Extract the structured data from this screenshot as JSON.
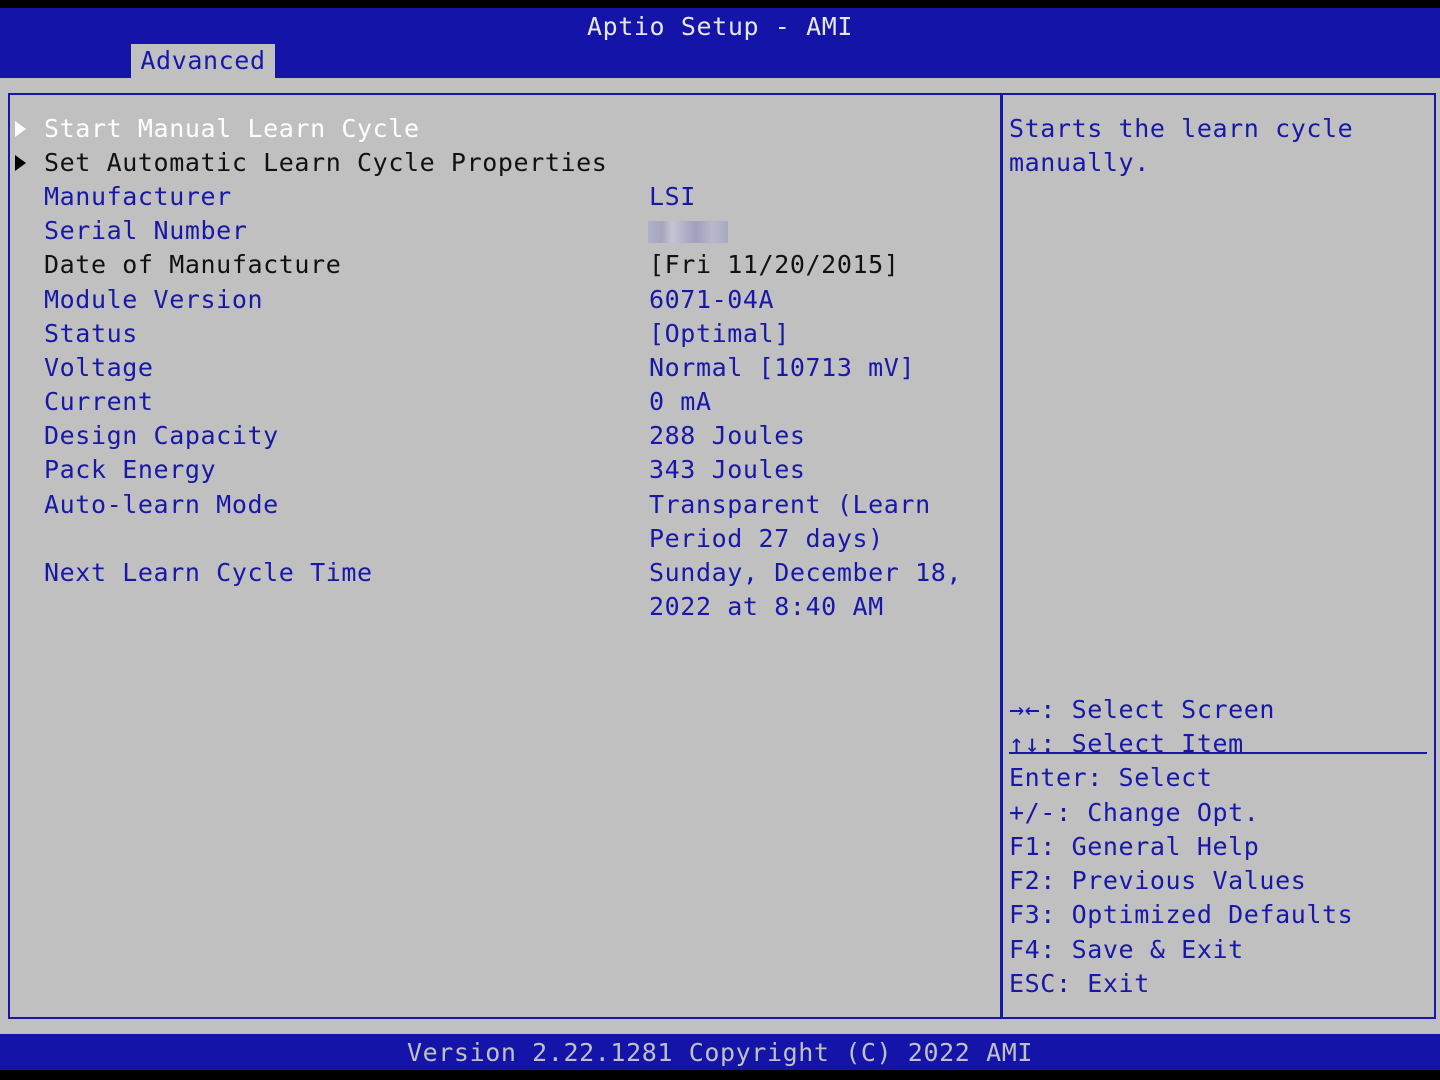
{
  "header": {
    "title": "Aptio Setup - AMI",
    "tab": "Advanced"
  },
  "menu": {
    "start_manual_learn_cycle": "Start Manual Learn Cycle",
    "set_automatic_learn_cycle": "Set Automatic Learn Cycle Properties"
  },
  "fields": {
    "manufacturer": {
      "label": "Manufacturer",
      "value": "LSI"
    },
    "serial_number": {
      "label": "Serial Number"
    },
    "date_of_manufacture": {
      "label": "Date of Manufacture",
      "value": "[Fri 11/20/2015]"
    },
    "module_version": {
      "label": "Module Version",
      "value": "6071-04A"
    },
    "status": {
      "label": "Status",
      "value": "[Optimal]"
    },
    "voltage": {
      "label": "Voltage",
      "value": "Normal [10713 mV]"
    },
    "current": {
      "label": "Current",
      "value": "0 mA"
    },
    "design_capacity": {
      "label": "Design Capacity",
      "value": "288 Joules"
    },
    "pack_energy": {
      "label": "Pack Energy",
      "value": "343 Joules"
    },
    "auto_learn_mode": {
      "label": "Auto-learn Mode",
      "value_line1": "Transparent (Learn",
      "value_line2": "Period 27 days)"
    },
    "next_learn_cycle_time": {
      "label": "Next Learn Cycle Time",
      "value_line1": "Sunday, December 18,",
      "value_line2": "2022 at 8:40 AM"
    }
  },
  "help": {
    "line1": "Starts the learn cycle",
    "line2": "manually."
  },
  "keys": [
    "→←: Select Screen",
    "↑↓: Select Item",
    "Enter: Select",
    "+/-: Change Opt.",
    "F1: General Help",
    "F2: Previous Values",
    "F3: Optimized Defaults",
    "F4: Save & Exit",
    "ESC: Exit"
  ],
  "footer": {
    "version": "Version 2.22.1281 Copyright (C) 2022 AMI"
  }
}
